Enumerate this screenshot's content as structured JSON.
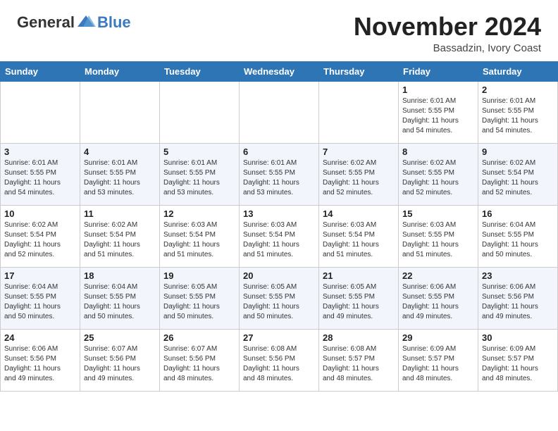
{
  "header": {
    "logo_general": "General",
    "logo_blue": "Blue",
    "month_title": "November 2024",
    "location": "Bassadzin, Ivory Coast"
  },
  "weekdays": [
    "Sunday",
    "Monday",
    "Tuesday",
    "Wednesday",
    "Thursday",
    "Friday",
    "Saturday"
  ],
  "weeks": [
    [
      {
        "day": "",
        "info": ""
      },
      {
        "day": "",
        "info": ""
      },
      {
        "day": "",
        "info": ""
      },
      {
        "day": "",
        "info": ""
      },
      {
        "day": "",
        "info": ""
      },
      {
        "day": "1",
        "info": "Sunrise: 6:01 AM\nSunset: 5:55 PM\nDaylight: 11 hours\nand 54 minutes."
      },
      {
        "day": "2",
        "info": "Sunrise: 6:01 AM\nSunset: 5:55 PM\nDaylight: 11 hours\nand 54 minutes."
      }
    ],
    [
      {
        "day": "3",
        "info": "Sunrise: 6:01 AM\nSunset: 5:55 PM\nDaylight: 11 hours\nand 54 minutes."
      },
      {
        "day": "4",
        "info": "Sunrise: 6:01 AM\nSunset: 5:55 PM\nDaylight: 11 hours\nand 53 minutes."
      },
      {
        "day": "5",
        "info": "Sunrise: 6:01 AM\nSunset: 5:55 PM\nDaylight: 11 hours\nand 53 minutes."
      },
      {
        "day": "6",
        "info": "Sunrise: 6:01 AM\nSunset: 5:55 PM\nDaylight: 11 hours\nand 53 minutes."
      },
      {
        "day": "7",
        "info": "Sunrise: 6:02 AM\nSunset: 5:55 PM\nDaylight: 11 hours\nand 52 minutes."
      },
      {
        "day": "8",
        "info": "Sunrise: 6:02 AM\nSunset: 5:55 PM\nDaylight: 11 hours\nand 52 minutes."
      },
      {
        "day": "9",
        "info": "Sunrise: 6:02 AM\nSunset: 5:54 PM\nDaylight: 11 hours\nand 52 minutes."
      }
    ],
    [
      {
        "day": "10",
        "info": "Sunrise: 6:02 AM\nSunset: 5:54 PM\nDaylight: 11 hours\nand 52 minutes."
      },
      {
        "day": "11",
        "info": "Sunrise: 6:02 AM\nSunset: 5:54 PM\nDaylight: 11 hours\nand 51 minutes."
      },
      {
        "day": "12",
        "info": "Sunrise: 6:03 AM\nSunset: 5:54 PM\nDaylight: 11 hours\nand 51 minutes."
      },
      {
        "day": "13",
        "info": "Sunrise: 6:03 AM\nSunset: 5:54 PM\nDaylight: 11 hours\nand 51 minutes."
      },
      {
        "day": "14",
        "info": "Sunrise: 6:03 AM\nSunset: 5:54 PM\nDaylight: 11 hours\nand 51 minutes."
      },
      {
        "day": "15",
        "info": "Sunrise: 6:03 AM\nSunset: 5:55 PM\nDaylight: 11 hours\nand 51 minutes."
      },
      {
        "day": "16",
        "info": "Sunrise: 6:04 AM\nSunset: 5:55 PM\nDaylight: 11 hours\nand 50 minutes."
      }
    ],
    [
      {
        "day": "17",
        "info": "Sunrise: 6:04 AM\nSunset: 5:55 PM\nDaylight: 11 hours\nand 50 minutes."
      },
      {
        "day": "18",
        "info": "Sunrise: 6:04 AM\nSunset: 5:55 PM\nDaylight: 11 hours\nand 50 minutes."
      },
      {
        "day": "19",
        "info": "Sunrise: 6:05 AM\nSunset: 5:55 PM\nDaylight: 11 hours\nand 50 minutes."
      },
      {
        "day": "20",
        "info": "Sunrise: 6:05 AM\nSunset: 5:55 PM\nDaylight: 11 hours\nand 50 minutes."
      },
      {
        "day": "21",
        "info": "Sunrise: 6:05 AM\nSunset: 5:55 PM\nDaylight: 11 hours\nand 49 minutes."
      },
      {
        "day": "22",
        "info": "Sunrise: 6:06 AM\nSunset: 5:55 PM\nDaylight: 11 hours\nand 49 minutes."
      },
      {
        "day": "23",
        "info": "Sunrise: 6:06 AM\nSunset: 5:56 PM\nDaylight: 11 hours\nand 49 minutes."
      }
    ],
    [
      {
        "day": "24",
        "info": "Sunrise: 6:06 AM\nSunset: 5:56 PM\nDaylight: 11 hours\nand 49 minutes."
      },
      {
        "day": "25",
        "info": "Sunrise: 6:07 AM\nSunset: 5:56 PM\nDaylight: 11 hours\nand 49 minutes."
      },
      {
        "day": "26",
        "info": "Sunrise: 6:07 AM\nSunset: 5:56 PM\nDaylight: 11 hours\nand 48 minutes."
      },
      {
        "day": "27",
        "info": "Sunrise: 6:08 AM\nSunset: 5:56 PM\nDaylight: 11 hours\nand 48 minutes."
      },
      {
        "day": "28",
        "info": "Sunrise: 6:08 AM\nSunset: 5:57 PM\nDaylight: 11 hours\nand 48 minutes."
      },
      {
        "day": "29",
        "info": "Sunrise: 6:09 AM\nSunset: 5:57 PM\nDaylight: 11 hours\nand 48 minutes."
      },
      {
        "day": "30",
        "info": "Sunrise: 6:09 AM\nSunset: 5:57 PM\nDaylight: 11 hours\nand 48 minutes."
      }
    ]
  ]
}
